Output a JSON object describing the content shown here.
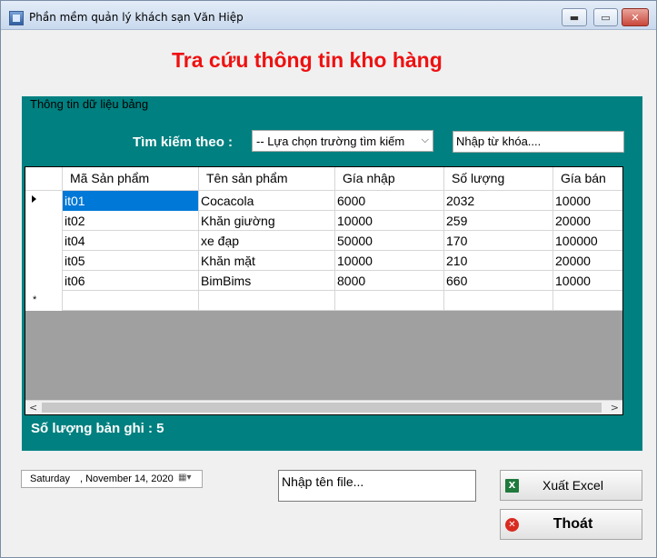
{
  "window": {
    "title": "Phần mềm quản lý khách sạn Văn Hiệp",
    "minimize_glyph": "▬",
    "maximize_glyph": "▭",
    "close_glyph": "✕"
  },
  "heading": "Tra cứu thông tin kho hàng",
  "group": {
    "title": "Thông tin dữ liệu  bảng",
    "search_label": "Tìm kiếm theo :",
    "search_field": {
      "selected": "-- Lựa chọn trường tìm kiếm",
      "arrow": "⌵"
    },
    "keyword_input": {
      "value": "Nhập từ khóa...."
    }
  },
  "grid": {
    "columns": [
      "Mã Sản phẩm",
      "Tên sản phẩm",
      "Gía nhập",
      "Số lượng",
      "Gía bán"
    ],
    "rows": [
      [
        "it01",
        "Cocacola",
        "6000",
        "2032",
        "10000"
      ],
      [
        "it02",
        "Khăn giường",
        "10000",
        "259",
        "20000"
      ],
      [
        "it04",
        "xe đạp",
        "50000",
        "170",
        "100000"
      ],
      [
        "it05",
        "Khăn mặt",
        "10000",
        "210",
        "20000"
      ],
      [
        "it06",
        "BimBims",
        "8000",
        "660",
        "10000"
      ]
    ],
    "new_row_marker": "*",
    "scroll_left": "<",
    "scroll_right": ">"
  },
  "record_count_label": "Số lượng bản ghi : 5",
  "date_picker": {
    "day": "Saturday",
    "date": ", November 14, 2020",
    "button": "▦▾"
  },
  "filename_input": {
    "value": "Nhập tên file..."
  },
  "buttons": {
    "excel": {
      "label": "Xuất Excel",
      "icon": "X",
      "icon_color": "#1f7a3c"
    },
    "exit": {
      "label": "Thoát",
      "icon": "✕",
      "icon_color": "#d92b20"
    }
  },
  "colors": {
    "heading": "#ee1111",
    "panel": "#008080",
    "selection": "#0078d7"
  }
}
